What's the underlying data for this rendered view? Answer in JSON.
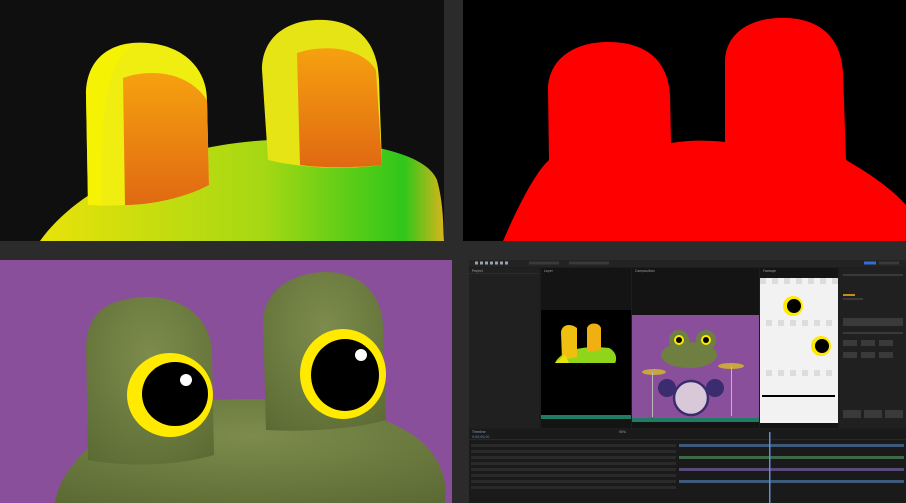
{
  "colors": {
    "background_gap": "#2b2b2b",
    "matte_red": "#ff0000",
    "backdrop_purple": "#8a4f9a",
    "frog_olive": "#6f7f42",
    "eye_yellow": "#ffea00",
    "ui_dark": "#1d1d1d",
    "ui_accent": "#2f6fd6"
  },
  "icons": [
    "select-tool-icon",
    "hand-tool-icon",
    "zoom-tool-icon",
    "pen-tool-icon",
    "text-tool-icon",
    "brush-tool-icon",
    "puppet-tool-icon"
  ],
  "editor": {
    "project_panel_tab": "Project",
    "comp_viewer_tab": "Composition",
    "layer_viewer_tab": "Layer",
    "footage_viewer_tab": "Footage",
    "timeline_tab": "Timeline",
    "zoom_level": "50%",
    "timecode": "0;00;00;00"
  }
}
